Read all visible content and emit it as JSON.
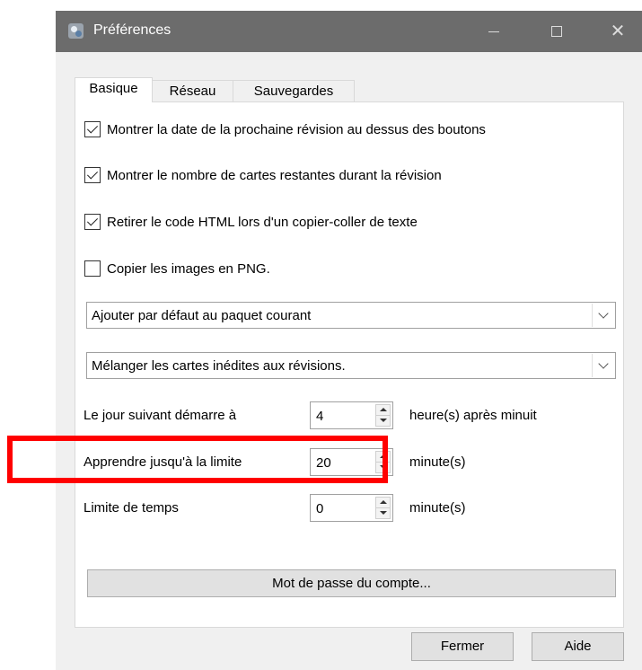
{
  "window": {
    "title": "Préférences",
    "icon": "app-icon",
    "controls": [
      "minimize-icon",
      "maximize-icon",
      "close-icon"
    ],
    "close_glyph": "✕"
  },
  "tabs": [
    {
      "label": "Basique",
      "active": true
    },
    {
      "label": "Réseau",
      "active": false
    },
    {
      "label": "Sauvegardes",
      "active": false
    }
  ],
  "checkboxes": [
    {
      "label": "Montrer la date de la prochaine révision au dessus des boutons",
      "checked": true
    },
    {
      "label": "Montrer le nombre de cartes restantes durant la révision",
      "checked": true
    },
    {
      "label": "Retirer le code HTML lors d'un copier-coller de texte",
      "checked": true
    },
    {
      "label": "Copier les images en PNG.",
      "checked": false
    }
  ],
  "selects": [
    {
      "value": "Ajouter par défaut au paquet courant"
    },
    {
      "value": "Mélanger les cartes inédites aux révisions."
    }
  ],
  "spinboxes": [
    {
      "label": "Le jour suivant démarre à",
      "value": "4",
      "unit": "heure(s) après minuit"
    },
    {
      "label": "Apprendre jusqu'à la limite",
      "value": "20",
      "unit": "minute(s)"
    },
    {
      "label": "Limite de temps",
      "value": "0",
      "unit": "minute(s)"
    }
  ],
  "account_button": "Mot de passe du compte...",
  "footer": {
    "close_label": "Fermer",
    "help_label": "Aide"
  },
  "colors": {
    "highlight": "#ff0000",
    "titlebar": "#6c6c6c"
  }
}
